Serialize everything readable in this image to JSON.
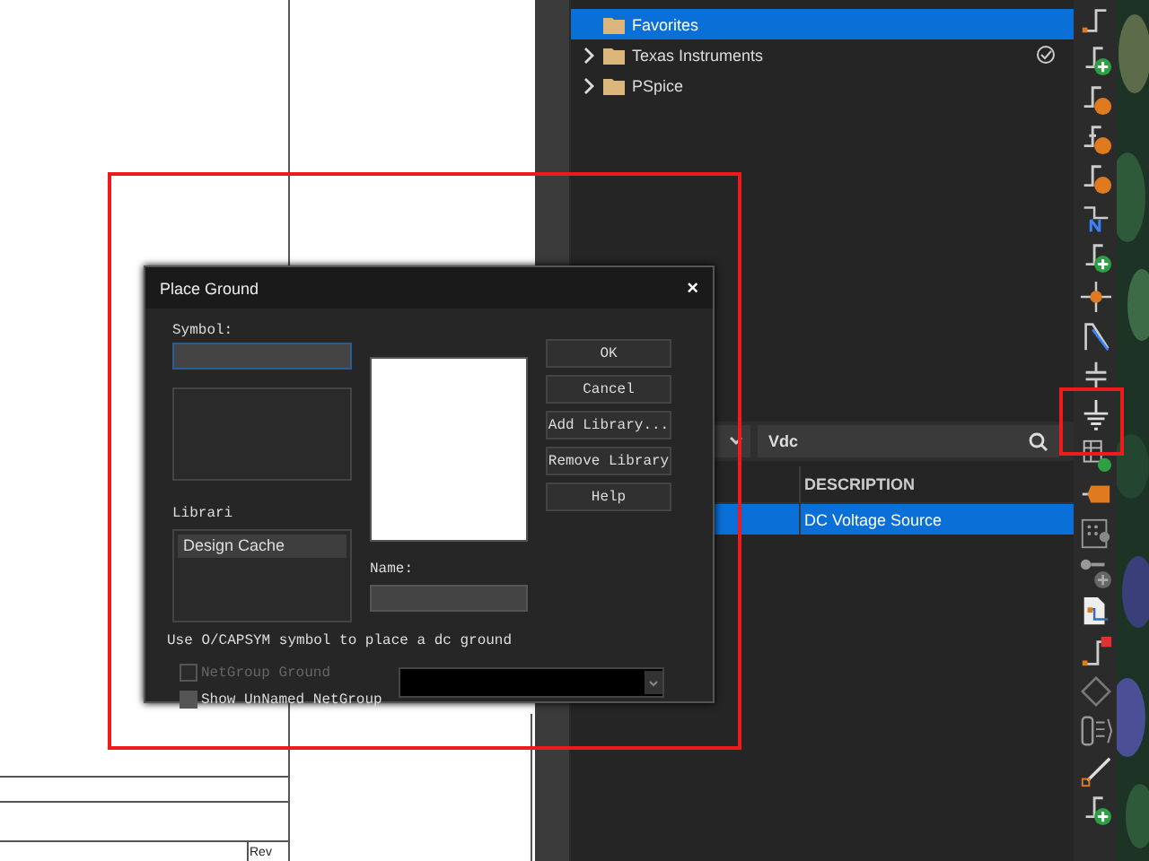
{
  "schematic": {
    "title_block_label": "Rev"
  },
  "tree": [
    {
      "label": "Favorites",
      "selected": true,
      "expandable": false,
      "verified": false
    },
    {
      "label": "Texas Instruments",
      "selected": false,
      "expandable": true,
      "verified": true
    },
    {
      "label": "PSpice",
      "selected": false,
      "expandable": true,
      "verified": false
    }
  ],
  "search": {
    "value": "Vdc"
  },
  "table": {
    "columns": [
      {
        "label": "DESCRIPTION"
      }
    ],
    "rows": [
      {
        "description": "DC Voltage Source",
        "selected": true
      }
    ]
  },
  "dialog": {
    "title": "Place Ground",
    "close": "×",
    "symbol_label": "Symbol:",
    "libraries_label": "Librari",
    "libraries": [
      {
        "label": "Design Cache",
        "selected": true
      }
    ],
    "name_label": "Name:",
    "buttons": [
      {
        "label": "OK"
      },
      {
        "label": "Cancel"
      },
      {
        "label": "Add Library..."
      },
      {
        "label": "Remove Library"
      },
      {
        "label": "Help"
      }
    ],
    "note": "Use O/CAPSYM symbol to place a dc ground",
    "options": [
      {
        "label": "NetGroup Ground",
        "checked": false,
        "disabled": true
      },
      {
        "label": "Show UnNamed NetGroup",
        "checked": false,
        "disabled": false
      }
    ]
  }
}
